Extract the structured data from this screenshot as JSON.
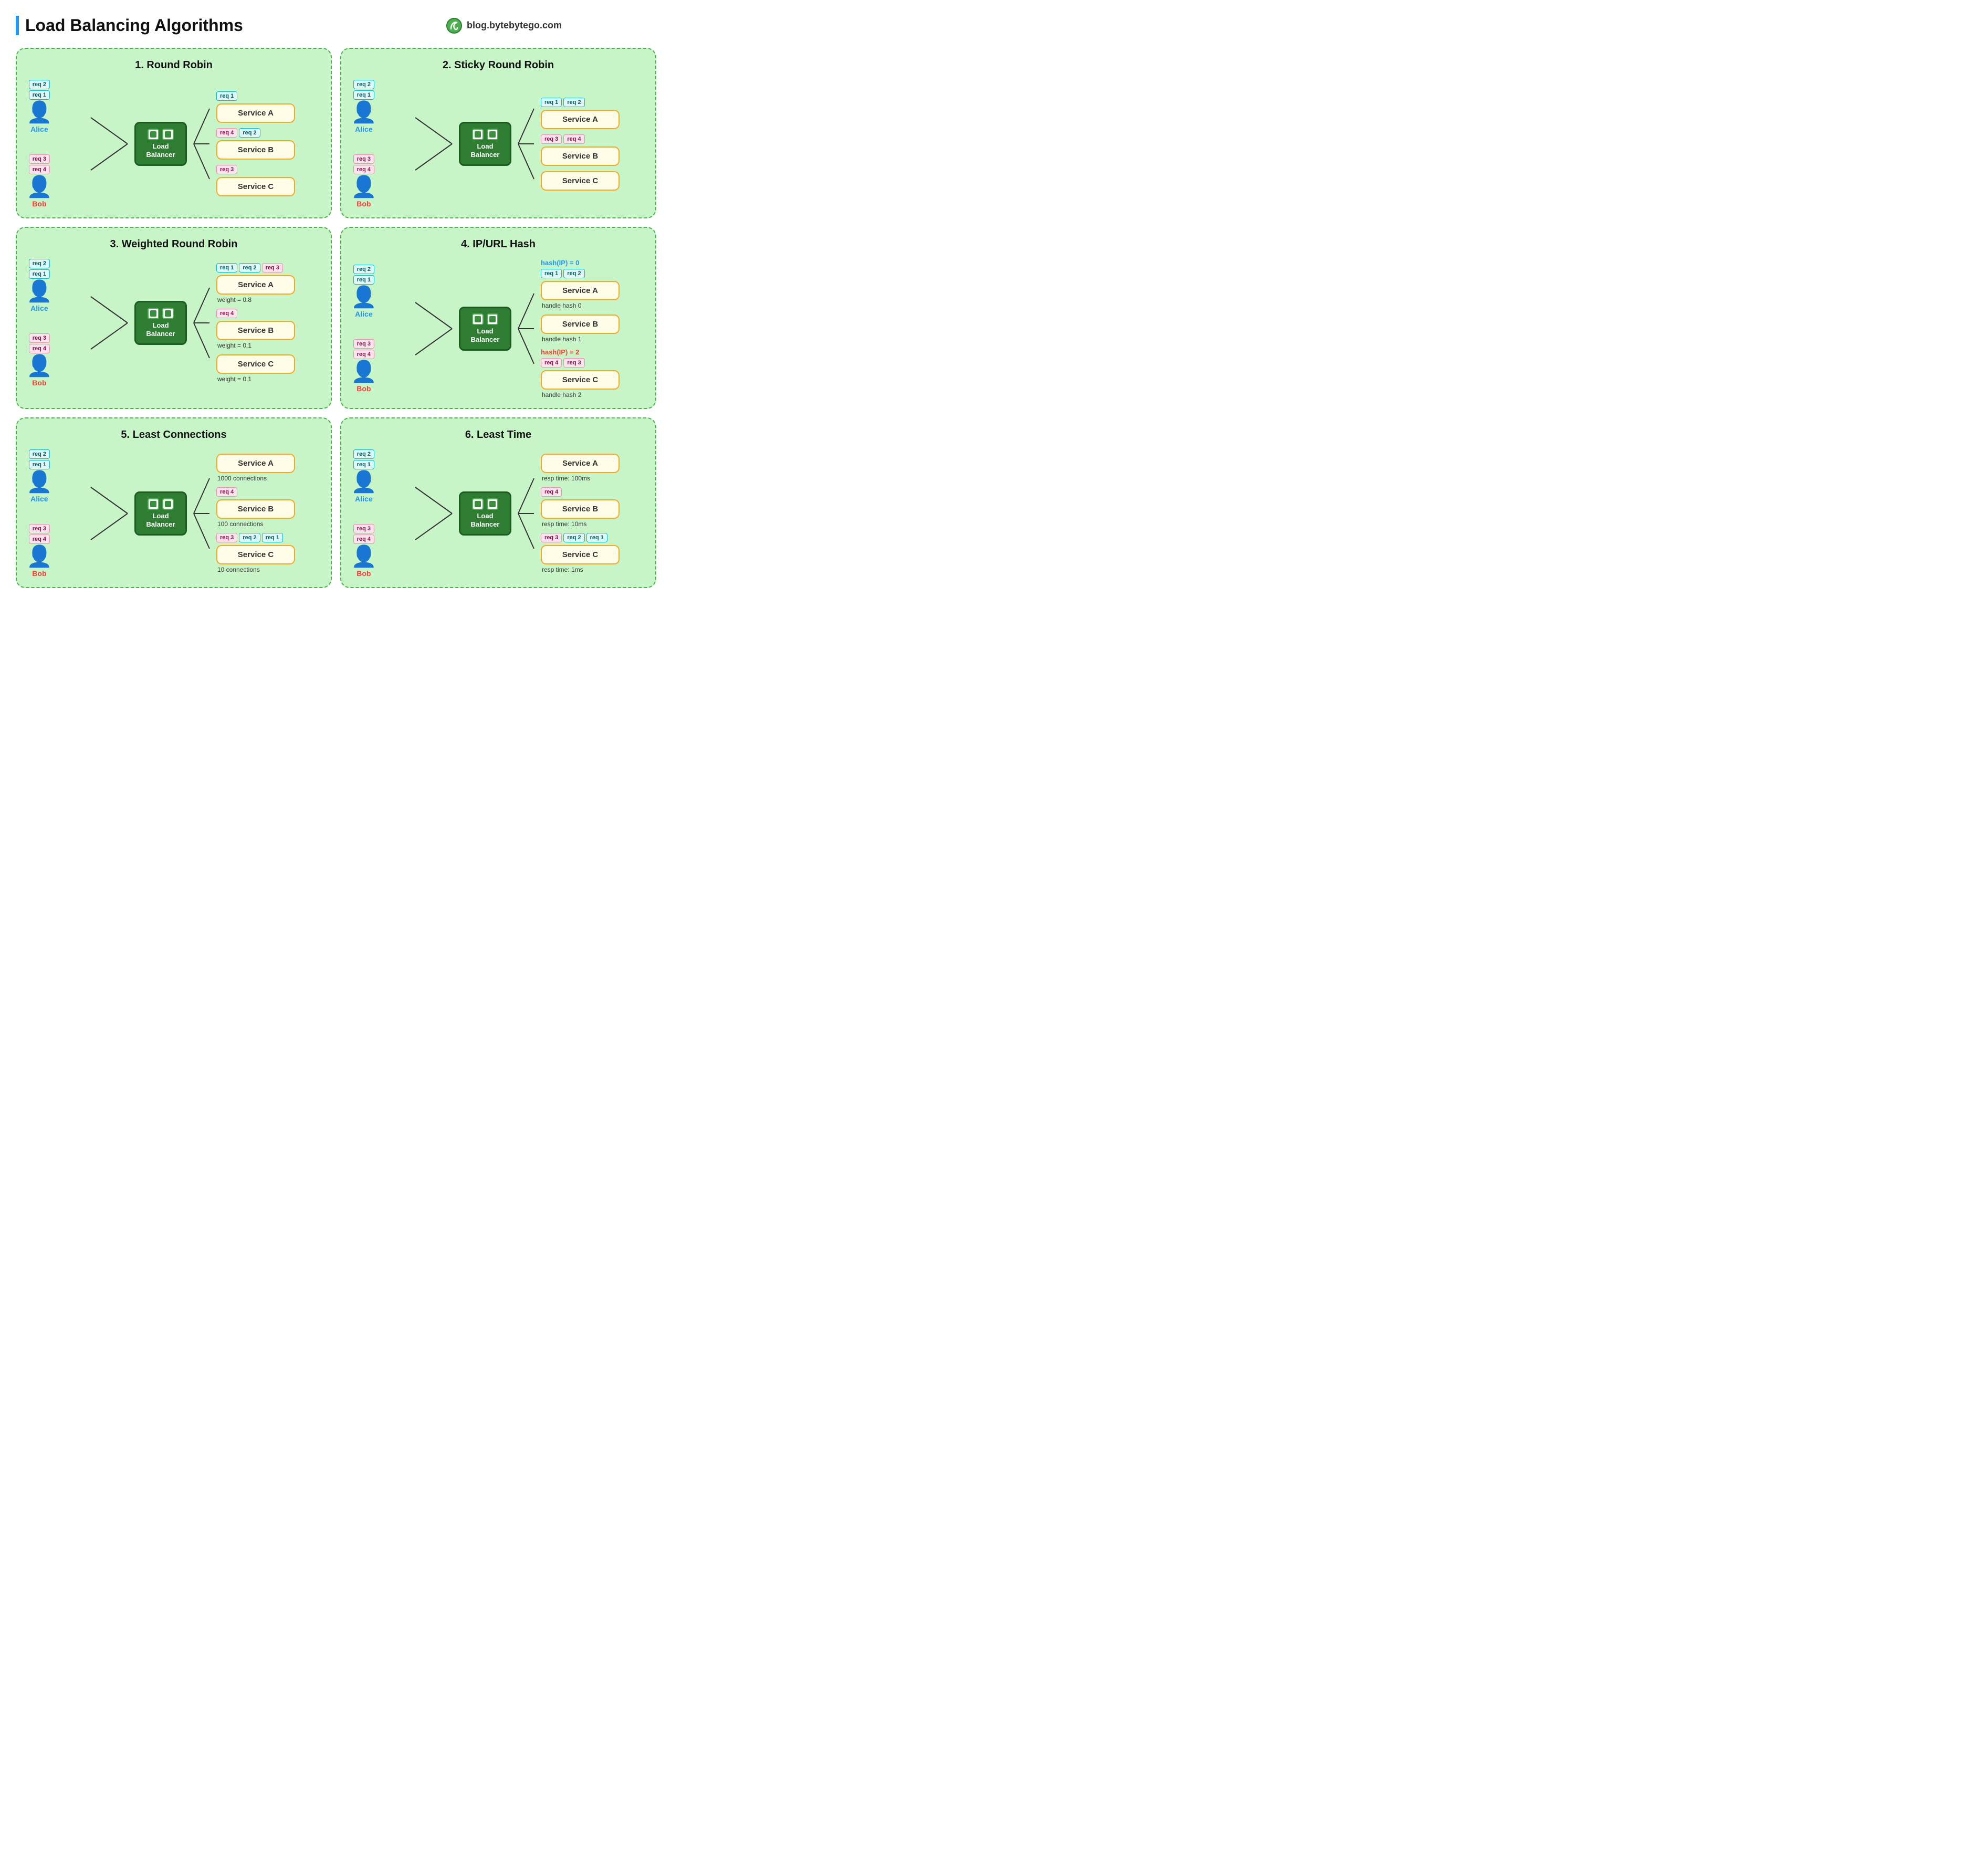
{
  "header": {
    "title": "Load Balancing Algorithms",
    "brand": "blog.bytebytego.com"
  },
  "panels": [
    {
      "id": "round-robin",
      "title": "1.  Round Robin",
      "alice": {
        "reqs": [
          "req 2",
          "req 1"
        ]
      },
      "bob": {
        "reqs": [
          "req 3",
          "req 4"
        ]
      },
      "lb": "Load\nBalancer",
      "services": [
        {
          "name": "Service A",
          "reqs_before": [
            "req 1"
          ],
          "reqs_after": [],
          "note": ""
        },
        {
          "name": "Service B",
          "reqs_before": [
            "req 4",
            "req 2"
          ],
          "reqs_after": [],
          "note": ""
        },
        {
          "name": "Service C",
          "reqs_before": [
            "req 3"
          ],
          "reqs_after": [],
          "note": ""
        }
      ]
    },
    {
      "id": "sticky-round-robin",
      "title": "2.  Sticky Round Robin",
      "alice": {
        "reqs": [
          "req 2",
          "req 1"
        ]
      },
      "bob": {
        "reqs": [
          "req 3",
          "req 4"
        ]
      },
      "lb": "Load\nBalancer",
      "services": [
        {
          "name": "Service A",
          "reqs_before": [
            "req 1",
            "req 2"
          ],
          "reqs_after": [],
          "note": ""
        },
        {
          "name": "Service B",
          "reqs_before": [
            "req 3",
            "req 4"
          ],
          "reqs_after": [],
          "note": ""
        },
        {
          "name": "Service C",
          "reqs_before": [],
          "reqs_after": [],
          "note": ""
        }
      ]
    },
    {
      "id": "weighted-round-robin",
      "title": "3.  Weighted Round Robin",
      "alice": {
        "reqs": [
          "req 2",
          "req 1"
        ]
      },
      "bob": {
        "reqs": [
          "req 3",
          "req 4"
        ]
      },
      "lb": "Load\nBalancer",
      "services": [
        {
          "name": "Service A",
          "reqs_before": [
            "req 1",
            "req 2",
            "req 3"
          ],
          "reqs_after": [],
          "note": "weight = 0.8"
        },
        {
          "name": "Service B",
          "reqs_before": [
            "req 4"
          ],
          "reqs_after": [],
          "note": "weight = 0.1"
        },
        {
          "name": "Service C",
          "reqs_before": [],
          "reqs_after": [],
          "note": "weight = 0.1"
        }
      ]
    },
    {
      "id": "ip-url-hash",
      "title": "4.  IP/URL Hash",
      "alice": {
        "reqs": [
          "req 2",
          "req 1"
        ]
      },
      "bob": {
        "reqs": [
          "req 3",
          "req 4"
        ]
      },
      "lb": "Load\nBalancer",
      "hash_alice": "hash(IP) = 0",
      "hash_bob": "hash(IP) = 2",
      "services": [
        {
          "name": "Service A",
          "reqs_before": [
            "req 1",
            "req 2"
          ],
          "reqs_after": [],
          "note": "handle hash 0"
        },
        {
          "name": "Service B",
          "reqs_before": [],
          "reqs_after": [],
          "note": "handle hash 1"
        },
        {
          "name": "Service C",
          "reqs_before": [
            "req 4",
            "req 3"
          ],
          "reqs_after": [],
          "note": "handle hash 2"
        }
      ]
    },
    {
      "id": "least-connections",
      "title": "5.  Least Connections",
      "alice": {
        "reqs": [
          "req 2",
          "req 1"
        ]
      },
      "bob": {
        "reqs": [
          "req 3",
          "req 4"
        ]
      },
      "lb": "Load\nBalancer",
      "services": [
        {
          "name": "Service A",
          "reqs_before": [],
          "reqs_after": [],
          "note": "1000 connections"
        },
        {
          "name": "Service B",
          "reqs_before": [
            "req 4"
          ],
          "reqs_after": [],
          "note": "100 connections"
        },
        {
          "name": "Service C",
          "reqs_before": [
            "req 3",
            "req 2",
            "req 1"
          ],
          "reqs_after": [],
          "note": "10 connections"
        }
      ]
    },
    {
      "id": "least-time",
      "title": "6.  Least Time",
      "alice": {
        "reqs": [
          "req 2",
          "req 1"
        ]
      },
      "bob": {
        "reqs": [
          "req 3",
          "req 4"
        ]
      },
      "lb": "Load\nBalancer",
      "services": [
        {
          "name": "Service A",
          "reqs_before": [],
          "reqs_after": [],
          "note": "resp time: 100ms"
        },
        {
          "name": "Service B",
          "reqs_before": [
            "req 4"
          ],
          "reqs_after": [],
          "note": "resp time: 10ms"
        },
        {
          "name": "Service C",
          "reqs_before": [
            "req 3",
            "req 2",
            "req 1"
          ],
          "reqs_after": [],
          "note": "resp time: 1ms"
        }
      ]
    }
  ],
  "labels": {
    "alice": "Alice",
    "bob": "Bob",
    "load_balancer": "Load\nBalancer"
  }
}
